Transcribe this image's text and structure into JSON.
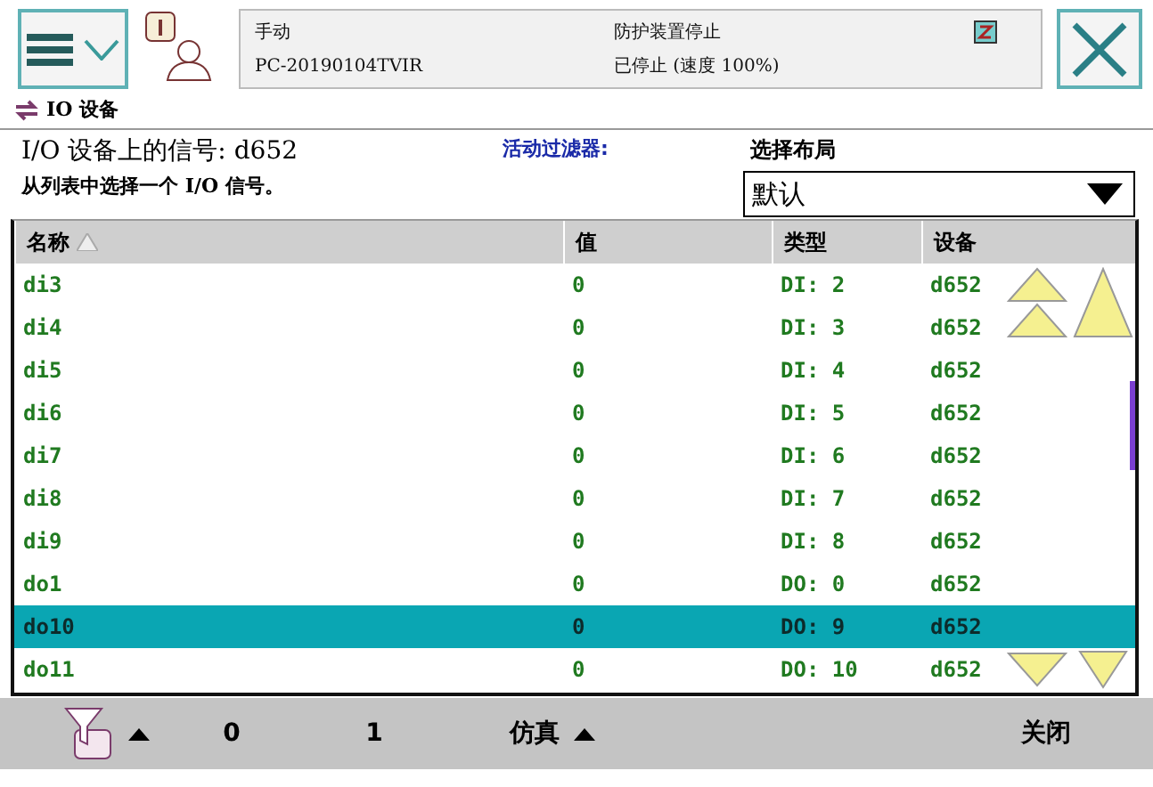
{
  "status": {
    "mode": "手动",
    "controller": "PC-20190104TVIR",
    "state": "防护装置停止",
    "speed": "已停止 (速度 100%)"
  },
  "app_title": "IO 设备",
  "info": {
    "title": "I/O 设备上的信号: d652",
    "hint": "从列表中选择一个 I/O 信号。",
    "filter_label": "活动过滤器:",
    "layout_label": "选择布局",
    "layout_value": "默认"
  },
  "table": {
    "columns": [
      "名称",
      "值",
      "类型",
      "设备"
    ],
    "rows": [
      {
        "name": "di3",
        "value": "0",
        "type": "DI: 2",
        "device": "d652",
        "selected": false
      },
      {
        "name": "di4",
        "value": "0",
        "type": "DI: 3",
        "device": "d652",
        "selected": false
      },
      {
        "name": "di5",
        "value": "0",
        "type": "DI: 4",
        "device": "d652",
        "selected": false
      },
      {
        "name": "di6",
        "value": "0",
        "type": "DI: 5",
        "device": "d652",
        "selected": false
      },
      {
        "name": "di7",
        "value": "0",
        "type": "DI: 6",
        "device": "d652",
        "selected": false
      },
      {
        "name": "di8",
        "value": "0",
        "type": "DI: 7",
        "device": "d652",
        "selected": false
      },
      {
        "name": "di9",
        "value": "0",
        "type": "DI: 8",
        "device": "d652",
        "selected": false
      },
      {
        "name": "do1",
        "value": "0",
        "type": "DO: 0",
        "device": "d652",
        "selected": false
      },
      {
        "name": "do10",
        "value": "0",
        "type": "DO: 9",
        "device": "d652",
        "selected": true
      },
      {
        "name": "do11",
        "value": "0",
        "type": "DO: 10",
        "device": "d652",
        "selected": false
      }
    ]
  },
  "toolbar": [
    "0",
    "1",
    "仿真",
    "关闭"
  ]
}
